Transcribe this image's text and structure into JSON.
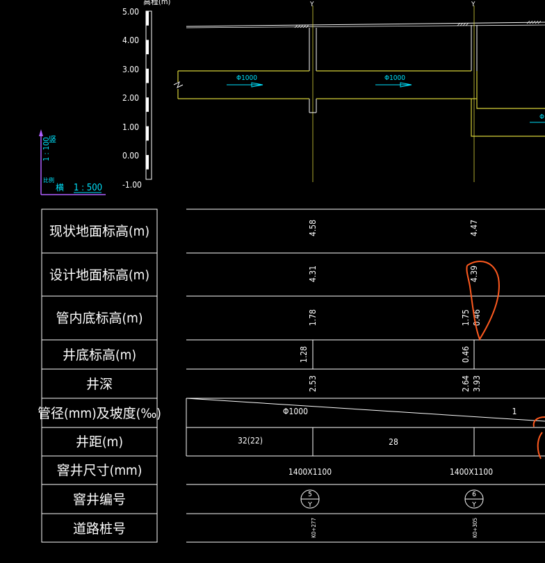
{
  "axis": {
    "unit": "高程(m)",
    "ticks": [
      "5.00",
      "4.00",
      "3.00",
      "2.00",
      "1.00",
      "0.00",
      "-1.00"
    ]
  },
  "scale": {
    "vertical": "1 : 100",
    "vertical_label": "竖",
    "horizontal": "1 : 500",
    "horizontal_label": "横",
    "small": "比例"
  },
  "wells": [
    {
      "marker": "Y",
      "ground": "4.58",
      "design": "4.31",
      "invert": "1.78",
      "bottom_left": "1.28",
      "depth": "2.53",
      "size": "1400X1100",
      "no": "5",
      "no_sub": "Y",
      "station": "K0+277"
    },
    {
      "marker": "Y",
      "ground": "4.47",
      "design": "4.39",
      "invert": "1.75",
      "invert2": "0.46",
      "bottom_left": "0.46",
      "depth": "2.64",
      "depth2": "3.93",
      "size": "1400X1100",
      "no": "6",
      "no_sub": "Y",
      "station": "K0+305"
    }
  ],
  "pipes": [
    {
      "label": "Φ1000"
    },
    {
      "label": "Φ1000"
    },
    {
      "label": "Φ"
    }
  ],
  "table": {
    "rows": [
      "现状地面标高(m)",
      "设计地面标高(m)",
      "管内底标高(m)",
      "井底标高(m)",
      "井深",
      "管径(mm)及坡度(‰)",
      "井距(m)",
      "窨井尺寸(mm)",
      "窨井编号",
      "道路桩号"
    ],
    "pipe_dia": "Φ1000",
    "slope": "1",
    "spacing1": "32(22)",
    "spacing2": "28"
  },
  "colors": {
    "bg": "#000000",
    "line": "#ffffff",
    "pipe": "#d8d23a",
    "cyan": "#00e5ff",
    "purple": "#b060ff",
    "markup": "#ff5a1f"
  }
}
